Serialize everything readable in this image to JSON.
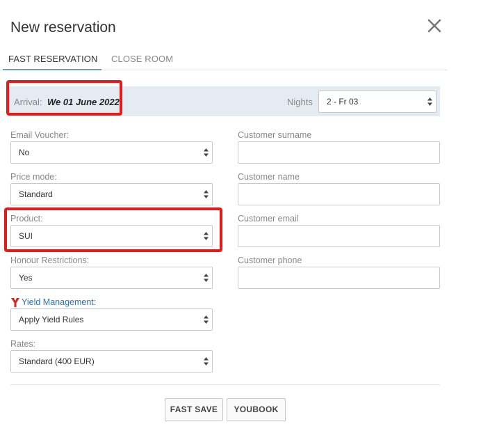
{
  "modal": {
    "title": "New reservation"
  },
  "tabs": [
    {
      "label": "FAST RESERVATION",
      "active": true
    },
    {
      "label": "CLOSE ROOM",
      "active": false
    }
  ],
  "arrival": {
    "label": "Arrival:",
    "value": "We 01 June 2022"
  },
  "nights": {
    "label": "Nights",
    "value": "2 - Fr 03"
  },
  "left_fields": {
    "email_voucher": {
      "label": "Email Voucher:",
      "value": "No"
    },
    "price_mode": {
      "label": "Price mode:",
      "value": "Standard"
    },
    "product": {
      "label": "Product:",
      "value": "SUI"
    },
    "honour_restrictions": {
      "label": "Honour Restrictions:",
      "value": "Yes"
    },
    "yield_management": {
      "label": "Yield Management:",
      "value": "Apply Yield Rules"
    },
    "rates": {
      "label": "Rates:",
      "value": "Standard (400 EUR)"
    }
  },
  "right_fields": {
    "customer_surname": {
      "label": "Customer surname",
      "value": ""
    },
    "customer_name": {
      "label": "Customer name",
      "value": ""
    },
    "customer_email": {
      "label": "Customer email",
      "value": ""
    },
    "customer_phone": {
      "label": "Customer phone",
      "value": ""
    }
  },
  "buttons": {
    "fast_save": "FAST SAVE",
    "youbook": "YOUBOOK"
  },
  "colors": {
    "highlight": "#e41b1b",
    "tab_underline": "#6d9bc3",
    "arrival_bg": "#e4ebf2",
    "yield_link": "#2a73b8",
    "yield_icon": "#d02828"
  },
  "icons": {
    "close": "close-icon",
    "select_arrows": "sort-arrows-icon",
    "yield": "yield-y-icon"
  }
}
